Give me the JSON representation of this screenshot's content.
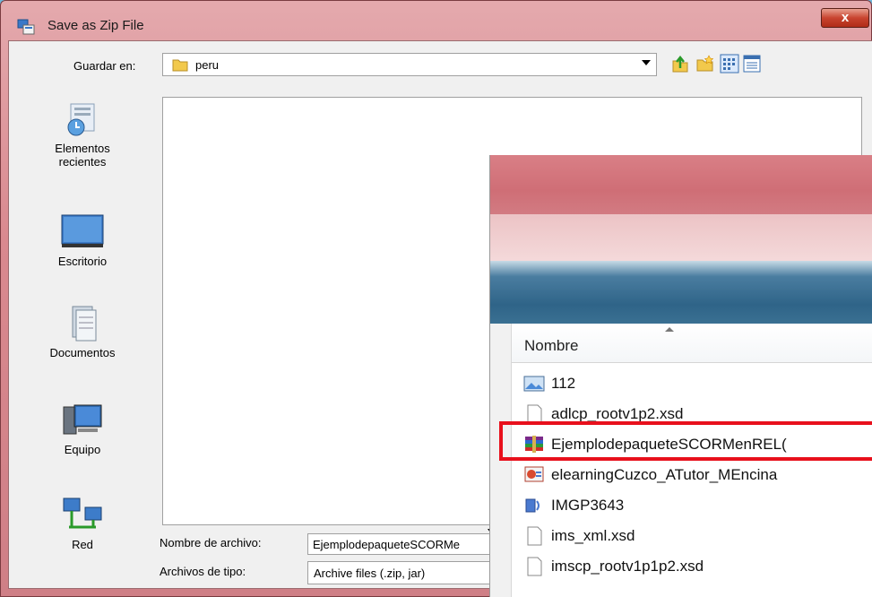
{
  "window": {
    "title": "Save as Zip File",
    "close_label": "x"
  },
  "save_in": {
    "label": "Guardar en:",
    "value": "peru"
  },
  "places": [
    {
      "label_line1": "Elementos",
      "label_line2": "recientes"
    },
    {
      "label_line1": "Escritorio",
      "label_line2": ""
    },
    {
      "label_line1": "Documentos",
      "label_line2": ""
    },
    {
      "label_line1": "Equipo",
      "label_line2": ""
    },
    {
      "label_line1": "Red",
      "label_line2": ""
    }
  ],
  "filename": {
    "label": "Nombre de archivo:",
    "value": "EjemplodepaqueteSCORMe"
  },
  "filetype": {
    "label": "Archivos de tipo:",
    "value": "Archive files (.zip, jar)"
  },
  "overlay": {
    "column_header": "Nombre",
    "files": [
      {
        "name": "112",
        "icon": "image-icon"
      },
      {
        "name": "adlcp_rootv1p2.xsd",
        "icon": "document-icon"
      },
      {
        "name": "EjemplodepaqueteSCORMenREL(",
        "icon": "winrar-archive-icon"
      },
      {
        "name": "elearningCuzco_ATutor_MEncina",
        "icon": "presentation-icon"
      },
      {
        "name": "IMGP3643",
        "icon": "media-icon"
      },
      {
        "name": "ims_xml.xsd",
        "icon": "document-icon"
      },
      {
        "name": "imscp_rootv1p1p2.xsd",
        "icon": "document-icon"
      }
    ]
  },
  "colors": {
    "highlight": "#e8101c",
    "title_gradient_top": "#e4a9ad"
  }
}
